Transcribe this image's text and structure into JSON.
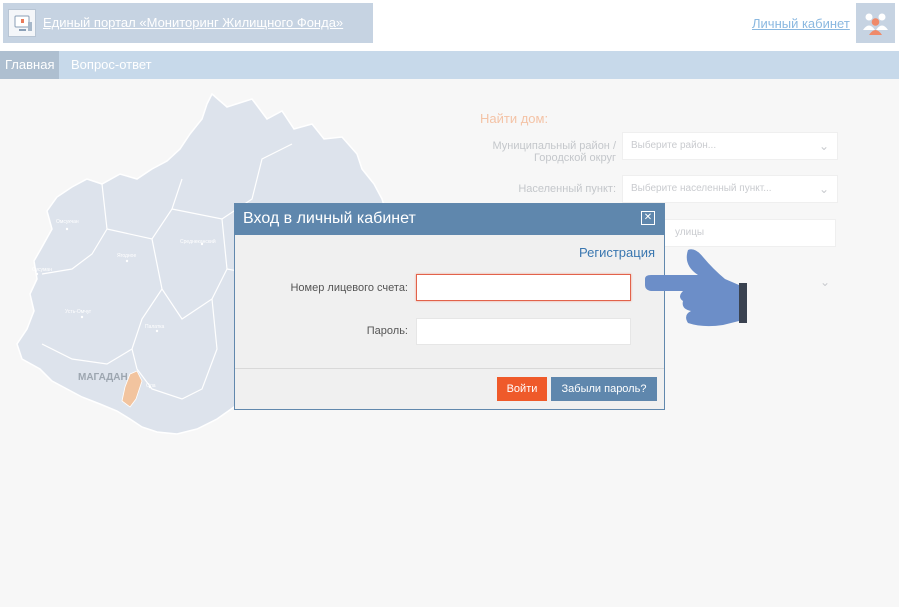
{
  "header": {
    "portal_title": "Единый портал «Мониторинг Жилищного Фонда»",
    "cabinet_link": "Личный кабинет",
    "logo_icon": "monitor-logo-icon",
    "avatar_icon": "users-group-icon"
  },
  "nav": {
    "items": [
      {
        "label": "Главная",
        "active": true
      },
      {
        "label": "Вопрос-ответ",
        "active": false
      }
    ]
  },
  "map": {
    "district_labels": [
      "Омсукчан",
      "Среднеканский",
      "Ягодное",
      "Сусуман",
      "Усть-Омчуг",
      "Палатка",
      "Ола"
    ],
    "city_label": "МАГАДАН"
  },
  "search": {
    "title": "Найти дом:",
    "district_label": "Муниципальный район / Городской округ",
    "district_placeholder": "Выберите район...",
    "locality_label": "Населенный пункт:",
    "locality_placeholder": "Выберите населенный пункт...",
    "street_placeholder": "улицы"
  },
  "login_modal": {
    "title": "Вход в личный кабинет",
    "register_link": "Регистрация",
    "account_label": "Номер лицевого счета:",
    "account_value": "",
    "password_label": "Пароль:",
    "password_value": "",
    "login_button": "Войти",
    "forgot_button": "Забыли пароль?"
  },
  "colors": {
    "modal_header": "#5f87ad",
    "accent_orange": "#ef5a2a",
    "link_blue": "#3a77b0",
    "nav_bar": "#c7d9ea"
  }
}
